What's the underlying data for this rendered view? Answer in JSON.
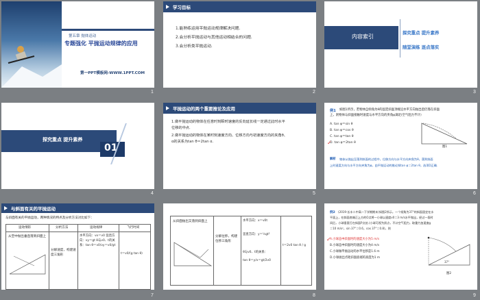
{
  "slide_numbers": [
    "1",
    "2",
    "3",
    "4",
    "5",
    "6",
    "7",
    "8",
    "9"
  ],
  "s1": {
    "chapter": "第五章  抛体运动",
    "title": "专题强化   平抛运动规律的应用",
    "footer": "第一PPT模板网-WWW.1PPT.COM"
  },
  "s2": {
    "heading": "学习目标",
    "goals": [
      "1.能熟练运用平抛运动规律解决问题.",
      "2.会分析平抛运动与其他运动相结合的问题.",
      "3.会分析类平抛运动."
    ]
  },
  "s3": {
    "label": "内容索引",
    "items": [
      "探究重点   提升素养",
      "随堂演练   逐点落实"
    ]
  },
  "s4": {
    "title": "探究重点   提升素养",
    "number": "01"
  },
  "s5": {
    "heading": "平抛运动的两个重要推论及应用",
    "lines": [
      "1.做平抛运动的物体在任意时刻瞬时速度的反向延长线一定通过此时水平",
      "位移的中点.",
      "2.做平抛运动的物体在某时刻速度方向、位移方向与初速度方向的夹角θ、",
      "α的关系为tan θ＝2tan α."
    ]
  },
  "s6": {
    "example_tag": "例1",
    "question": [
      "如图1所示，若物体自倾角为θ的固定斜面顶端沿水平方向抛出后仍落在斜面",
      "上，则物体与斜面接触时速度与水平方向的夹角φ满足(空气阻力不计)"
    ],
    "options": [
      "A. tan φ＝sin θ",
      "B. tan φ＝cos θ",
      "C. tan φ＝tan θ",
      "D. tan φ＝2tan θ"
    ],
    "fig_label": "图1",
    "analysis_tag": "解析",
    "analysis": [
      "物体从抛出至落到斜面的过程中，位移方向与水平方向夹角为θ，落到斜面",
      "上时速度方向与水平方向夹角为φ，由平抛运动的推论知tan φ＝2tan θ，选项D正确."
    ]
  },
  "s7": {
    "heading": "与斜面有关的平抛运动",
    "intro": "与斜面有关的平抛运动，两种情况的特点及分析方法对比如下：",
    "columns": [
      "运动情形",
      "分析方法",
      "运动规律",
      "飞行时间"
    ],
    "row": [
      "从空中抛出垂直落到斜面上",
      "分解速度，构建速度三角形",
      "水平方向：vx＝v0  竖直方向：vy＝gt  θ与v0、t的关系：tan θ＝v0/vy＝v0/gt",
      "t＝v0/(g tan θ)"
    ]
  },
  "s8": {
    "col1": "从斜面抛出又落到斜面上",
    "col2": "分解位移，构建位移三角形",
    "col3": [
      "水平方向：x＝v0t",
      "竖直方向：y＝½gt²",
      "θ与v0、t的关系：",
      "tan θ＝y/x＝gt/2v0"
    ],
    "col4": "t＝2v0 tan θ / g"
  },
  "s9": {
    "example_tag": "例2",
    "question": [
      "(2019·长丰二中高一下学期期末)如图2所示，一个倾角为37°的斜面固定在水",
      "平面上，在斜面底端正上方的O点将一小球以速度v0＝3 m/s水平抛出，经过一段时",
      "间后，小球垂直打在斜面P点处.(小球可视为质点，不计空气阻力，取重力加速度g",
      "＝10 m/s²，sin 37°＝0.6，cos 37°＝0.8)，则"
    ],
    "options": [
      "A.小球击中斜面时的速度大小为5 m/s",
      "B.小球击中斜面时的速度大小为4 m/s",
      "C.小球做平抛运动的水平位移是1.6 m",
      "D.小球抛出点距斜面底端的高度为1 m"
    ],
    "fig_label": "图2",
    "angle": "37°"
  }
}
